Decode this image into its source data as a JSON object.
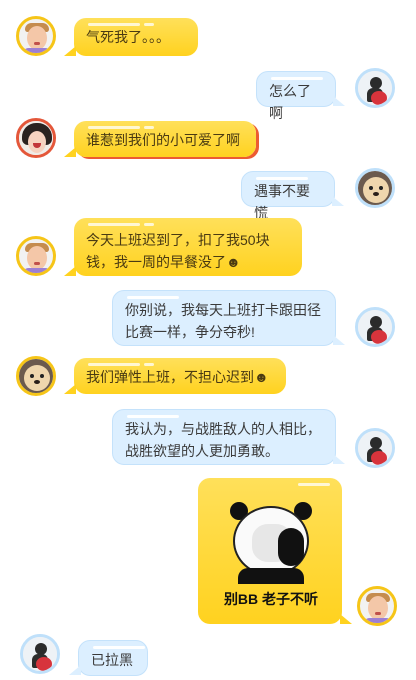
{
  "messages": [
    {
      "side": "left",
      "text": "气死我了。。。",
      "avatar": "boy-icon"
    },
    {
      "side": "right",
      "text": "怎么了啊",
      "avatar": "figure-icon"
    },
    {
      "side": "left",
      "text": "谁惹到我们的小可爱了啊",
      "avatar": "girl-icon"
    },
    {
      "side": "right",
      "text": "遇事不要慌",
      "avatar": "dog-icon"
    },
    {
      "side": "left",
      "text": "今天上班迟到了，扣了我50块钱，我一周的早餐没了☻",
      "avatar": "boy-icon"
    },
    {
      "side": "right",
      "text": "你别说，我每天上班打卡跟田径比赛一样，争分夺秒!",
      "avatar": "figure-icon"
    },
    {
      "side": "left",
      "text": "我们弹性上班，不担心迟到☻",
      "avatar": "dog-icon"
    },
    {
      "side": "right",
      "text": "我认为，与战胜敌人的人相比，战胜欲望的人更加勇敢。",
      "avatar": "figure-icon"
    },
    {
      "side": "right",
      "sticker_caption": "别BB 老子不听",
      "avatar": "boy-icon"
    },
    {
      "side": "left",
      "text": "已拉黑",
      "avatar": "figure-icon"
    }
  ],
  "colors": {
    "yellow": "#ffd21f",
    "blue": "#dcefff",
    "accent_red": "#ec5b32"
  }
}
